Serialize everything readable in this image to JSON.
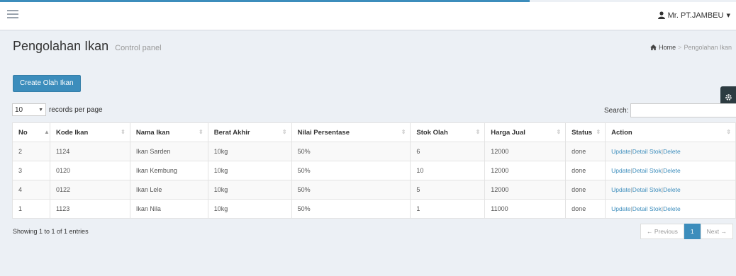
{
  "header": {
    "progress_fraction": 0.72,
    "user_name": "Mr. PT.JAMBEU",
    "user_caret": "▾"
  },
  "content_header": {
    "title": "Pengolahan Ikan",
    "subtitle": "Control panel",
    "breadcrumb": [
      "Home",
      "Pengolahan Ikan"
    ]
  },
  "toolbar": {
    "create_label": "Create Olah Ikan"
  },
  "table_controls": {
    "page_length_value": "10",
    "records_per_page_label": "records per page",
    "search_label": "Search:",
    "search_value": ""
  },
  "table": {
    "columns": [
      "No",
      "Kode Ikan",
      "Nama Ikan",
      "Berat Akhir",
      "Nilai Persentase",
      "Stok Olah",
      "Harga Jual",
      "Status",
      "Action"
    ],
    "rows": [
      [
        "2",
        "1124",
        "Ikan Sarden",
        "10kg",
        "50%",
        "6",
        "12000",
        "done"
      ],
      [
        "3",
        "0120",
        "Ikan Kembung",
        "10kg",
        "50%",
        "10",
        "12000",
        "done"
      ],
      [
        "4",
        "0122",
        "Ikan Lele",
        "10kg",
        "50%",
        "5",
        "12000",
        "done"
      ],
      [
        "1",
        "1123",
        "Ikan Nila",
        "10kg",
        "50%",
        "1",
        "11000",
        "done"
      ]
    ],
    "actions": {
      "update": "Update",
      "detail": "Detail Stok",
      "delete": "Delete",
      "separator": "|"
    }
  },
  "footer": {
    "info": "Showing 1 to 1 of 1 entries",
    "prev_label": "← Previous",
    "current_page": "1",
    "next_label": "Next →"
  },
  "colors": {
    "accent": "#3c8dbc",
    "background": "#ecf0f5",
    "gear_tab": "#2c3b41"
  },
  "icons": {
    "menu": "hamburger-icon",
    "user": "user-icon",
    "home": "home-icon",
    "gear": "gear-icon",
    "sort": "sort-icon"
  }
}
